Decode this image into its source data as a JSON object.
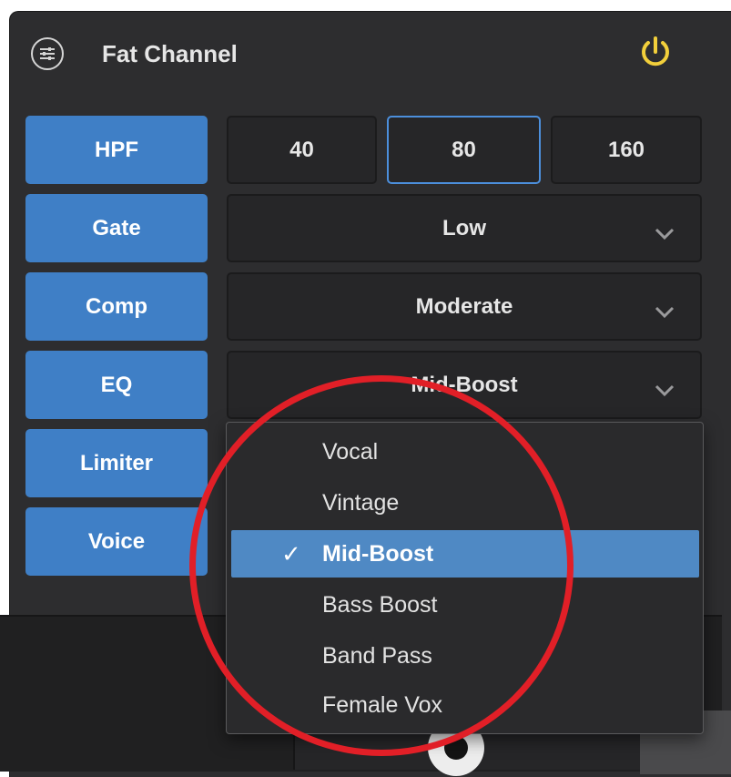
{
  "header": {
    "title": "Fat Channel",
    "power_color": "#f2cf3b"
  },
  "sidebar": {
    "buttons": [
      {
        "label": "HPF"
      },
      {
        "label": "Gate"
      },
      {
        "label": "Comp"
      },
      {
        "label": "EQ"
      },
      {
        "label": "Limiter"
      },
      {
        "label": "Voice"
      }
    ]
  },
  "hpf": {
    "options": [
      "40",
      "80",
      "160"
    ],
    "selected": "80"
  },
  "gate": {
    "value": "Low"
  },
  "comp": {
    "value": "Moderate"
  },
  "eq": {
    "value": "Mid-Boost"
  },
  "eq_menu": {
    "items": [
      {
        "label": "Vocal"
      },
      {
        "label": "Vintage"
      },
      {
        "label": "Mid-Boost",
        "checked": true
      },
      {
        "label": "Bass Boost"
      },
      {
        "label": "Band Pass"
      },
      {
        "label": "Female Vox"
      }
    ],
    "check_glyph": "✓"
  },
  "colors": {
    "accent_button": "#3f7fc6",
    "selection": "#4f89c4",
    "annotation_circle": "#e11f27"
  }
}
